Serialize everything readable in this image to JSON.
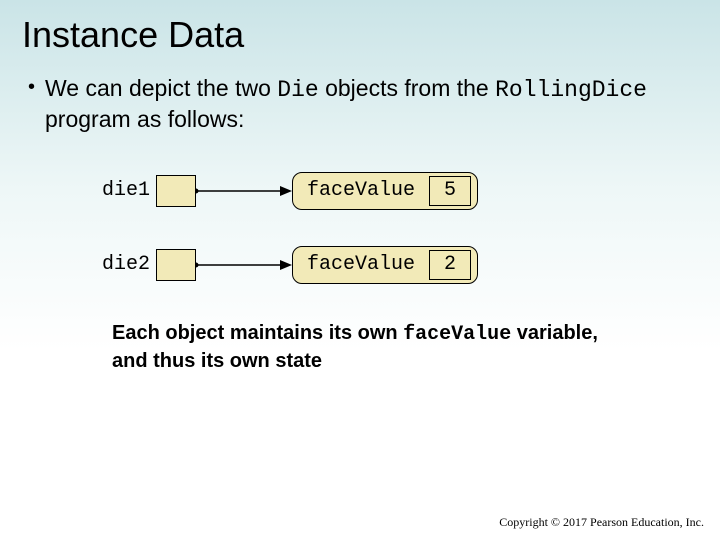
{
  "title": "Instance Data",
  "bullet": {
    "pre": "We can depict the two ",
    "code1": "Die",
    "mid": " objects from the ",
    "code2": "RollingDice",
    "post": " program as follows:"
  },
  "objects": [
    {
      "var": "die1",
      "field": "faceValue",
      "value": "5"
    },
    {
      "var": "die2",
      "field": "faceValue",
      "value": "2"
    }
  ],
  "caption": {
    "p1": "Each object maintains its own ",
    "code": "faceValue",
    "p2": " variable, and thus its own state"
  },
  "copyright": "Copyright © 2017 Pearson Education, Inc."
}
